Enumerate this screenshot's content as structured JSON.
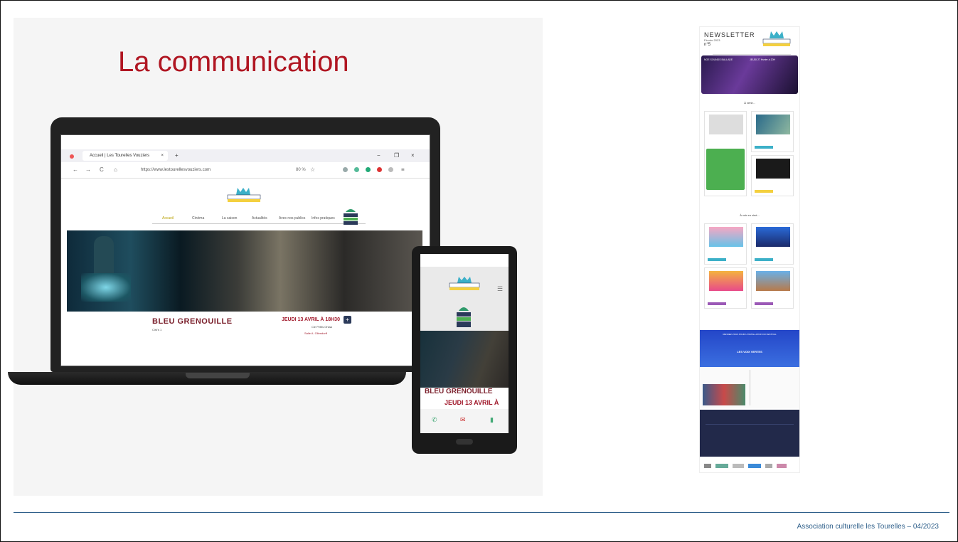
{
  "slide": {
    "title": "La communication",
    "footer": "Association culturelle les Tourelles – 04/2023"
  },
  "browser": {
    "tab_label": "Accueil | Les Tourelles Vouziers",
    "tab_close": "×",
    "new_tab": "+",
    "minimize": "−",
    "maximize": "❐",
    "close": "×",
    "url": "https://www.lestourellesvouziers.com",
    "zoom": "80 %",
    "back": "←",
    "forward": "→",
    "reload": "C",
    "home": "⌂"
  },
  "website": {
    "nav": [
      "Accueil",
      "Cinéma",
      "La saison",
      "Actualités",
      "Avec nos publics",
      "Infos pratiques"
    ],
    "event_title": "BLEU GRENOUILLE",
    "event_sub": "Cirk's 1",
    "event_date": "JEUDI 13 AVRIL À 18H30",
    "event_detail": "Cie Petits Ohlaa",
    "event_venue": "Salle A. Ollendorff",
    "plus": "+"
  },
  "phone": {
    "menu": "☰",
    "event_title": "BLEU GRENOUILLE",
    "event_date": "JEUDI 13 AVRIL À"
  },
  "newsletter": {
    "heading": "NEWSLETTER",
    "subtitle": "Février 2023",
    "number": "n°5",
    "section_avenir": "À venir...",
    "section_voir": "À voir en ciné...",
    "hero_left": "NOE SOUNDS BALLADE",
    "hero_right": "JEUDI 27 février à 20H",
    "blue_title": "LES VOIX VERTES",
    "blue_header": "RENDEZ-VOUS POUR L'INSTALLATION DU FESTIVAL"
  },
  "colors": {
    "title": "#b01622",
    "footer": "#2e5f8a",
    "event": "#7a1f2b",
    "accent_green": "#4caf50",
    "accent_blue": "#2446c8"
  }
}
